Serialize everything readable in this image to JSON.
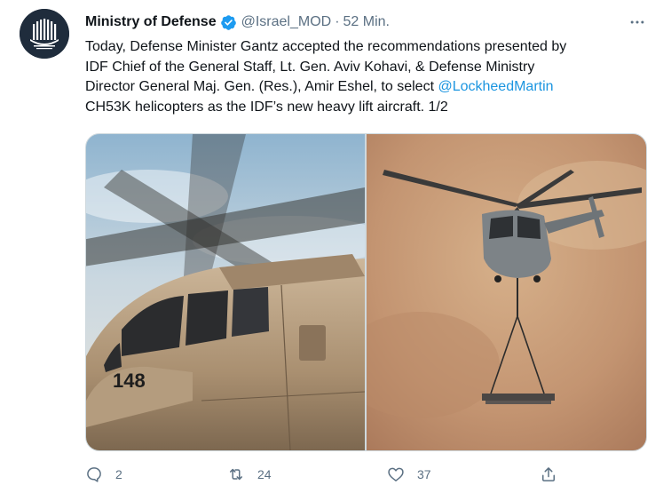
{
  "author": {
    "display_name": "Ministry of Defense",
    "handle": "@Israel_MOD",
    "separator": "·",
    "time": "52 Min.",
    "verified": true,
    "avatar_icon": "ministry-logo-icon"
  },
  "tweet": {
    "line1": "Today, Defense Minister Gantz accepted the recommendations presented by",
    "line2": "IDF Chief of the General Staff, Lt. Gen. Aviv Kohavi, & Defense Ministry",
    "line3": "Director General Maj. Gen. (Res.), Amir Eshel, to select ",
    "mention": "@LockheedMartin",
    "line4": "CH53K helicopters as the IDF’s new heavy lift aircraft. 1/2"
  },
  "media": {
    "left_photo_marking": "148"
  },
  "actions": {
    "reply_count": "2",
    "retweet_count": "24",
    "like_count": "37"
  },
  "colors": {
    "accent": "#1d9bf0",
    "link": "#1b95e0",
    "muted": "#5b7083"
  }
}
